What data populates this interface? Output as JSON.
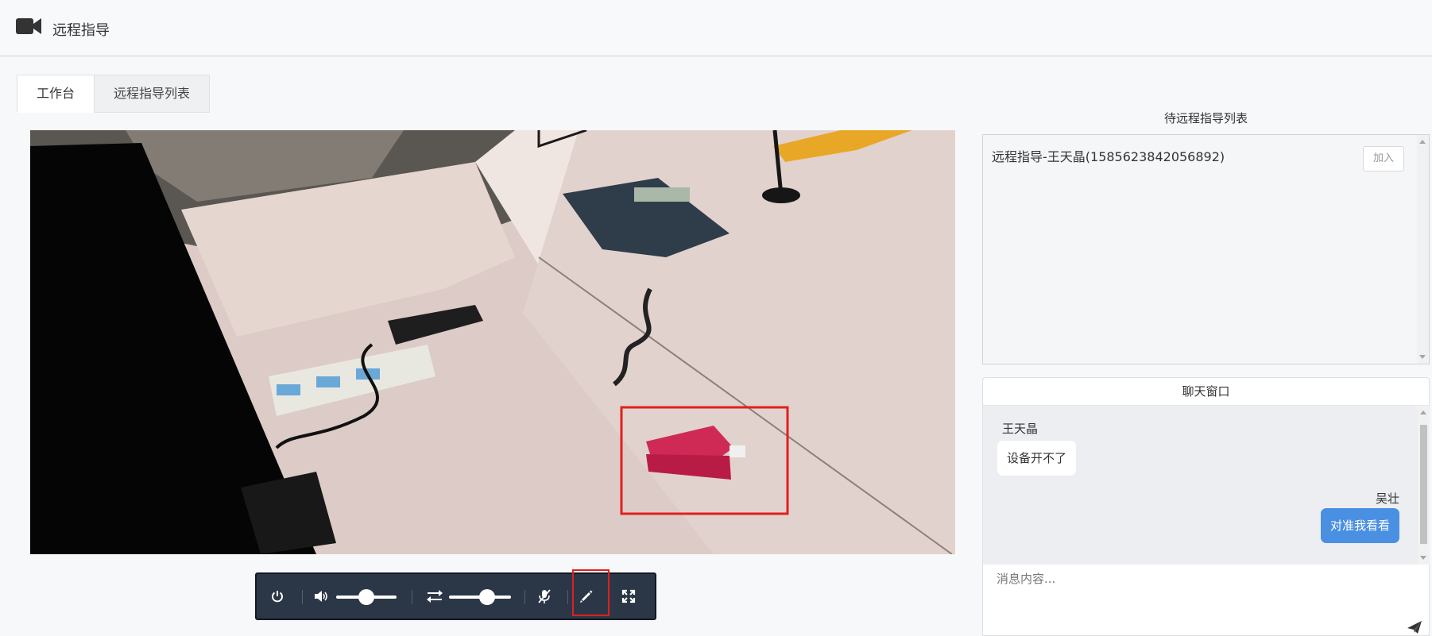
{
  "header": {
    "title": "远程指导",
    "icon": "video-camera-icon"
  },
  "tabs": [
    {
      "label": "工作台",
      "active": true
    },
    {
      "label": "远程指导列表",
      "active": false
    }
  ],
  "controls": {
    "icons": [
      "power-icon",
      "volume-icon",
      "swap-icon",
      "mute-mic-icon",
      "pencil-icon",
      "fullscreen-icon"
    ],
    "volume_level": 0.5,
    "swap_level": 0.62
  },
  "queue": {
    "title": "待远程指导列表",
    "items": [
      {
        "label": "远程指导-王天晶(1585623842056892)",
        "action": "加入"
      }
    ]
  },
  "chat": {
    "title": "聊天窗口",
    "messages": [
      {
        "sender": "王天晶",
        "text": "设备开不了",
        "direction": "in"
      },
      {
        "sender": "吴壮",
        "text": "对准我看看",
        "direction": "out"
      }
    ],
    "input_placeholder": "消息内容..."
  },
  "colors": {
    "accent": "#4a90e2",
    "toolbar": "#2b3747",
    "highlight": "#e0201e"
  }
}
